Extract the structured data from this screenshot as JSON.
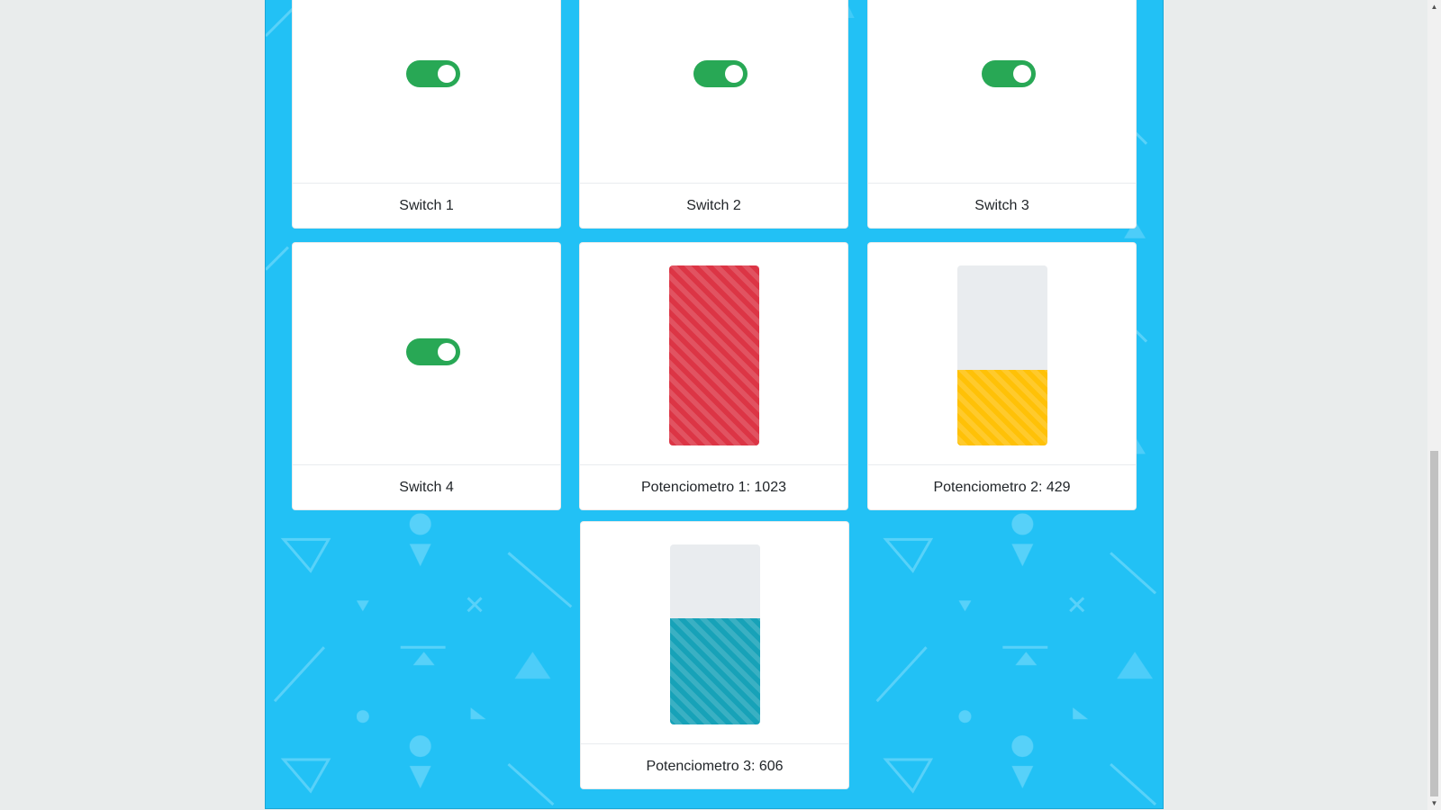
{
  "colors": {
    "panel_background": "#22c1f5",
    "toggle_on": "#28a855",
    "bar_track": "#e9ecef",
    "potenciometro_1": "#dc3545",
    "potenciometro_2": "#ffc107",
    "potenciometro_3": "#17a2b8"
  },
  "switches": [
    {
      "label": "Switch 1",
      "state": "on"
    },
    {
      "label": "Switch 2",
      "state": "on"
    },
    {
      "label": "Switch 3",
      "state": "on"
    },
    {
      "label": "Switch 4",
      "state": "on"
    }
  ],
  "potenciometros": [
    {
      "label": "Potenciometro 1: 1023",
      "value": 1023,
      "max": 1023,
      "level": 1.0
    },
    {
      "label": "Potenciometro 2: 429",
      "value": 429,
      "max": 1023,
      "level": 0.42
    },
    {
      "label": "Potenciometro 3: 606",
      "value": 606,
      "max": 1023,
      "level": 0.59
    }
  ],
  "scrollbar": {
    "up_icon": "triangle-up-icon",
    "down_icon": "triangle-down-icon"
  }
}
